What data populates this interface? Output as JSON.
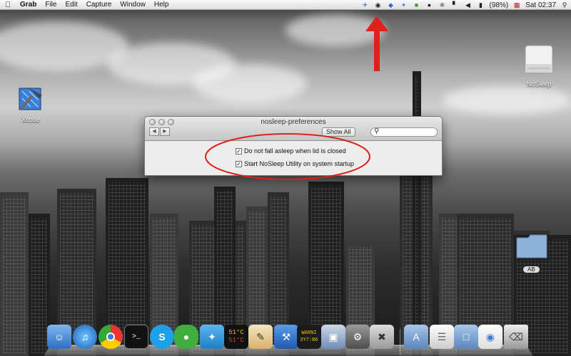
{
  "menubar": {
    "apple_icon": "apple-logo-icon",
    "app_name": "Grab",
    "menus": [
      "File",
      "Edit",
      "Capture",
      "Window",
      "Help"
    ],
    "status": {
      "battery": "(98%)",
      "time": "Sat 02:37"
    }
  },
  "desktop": {
    "icons": [
      {
        "label": "Xcode",
        "icon": "xcode-hammer-icon"
      },
      {
        "label": "NoSleep",
        "icon": "drive-icon"
      }
    ],
    "folder_stack_label": "AB"
  },
  "window": {
    "title": "nosleep-preferences",
    "nav_back": "◀",
    "nav_forward": "▶",
    "show_all_label": "Show All",
    "search": {
      "value": "",
      "placeholder": ""
    },
    "options": [
      {
        "label": "Do not fall asleep when lid is closed",
        "checked": true
      },
      {
        "label": "Start NoSleep Utility on system startup",
        "checked": true
      }
    ]
  },
  "dock": {
    "temp_widget": [
      "51°C",
      "51°C"
    ],
    "warn_widget": [
      "WARNI",
      "3Y7:B6"
    ]
  },
  "colors": {
    "annotation_red": "#e0201b",
    "menubar_bg": "#ececec"
  }
}
